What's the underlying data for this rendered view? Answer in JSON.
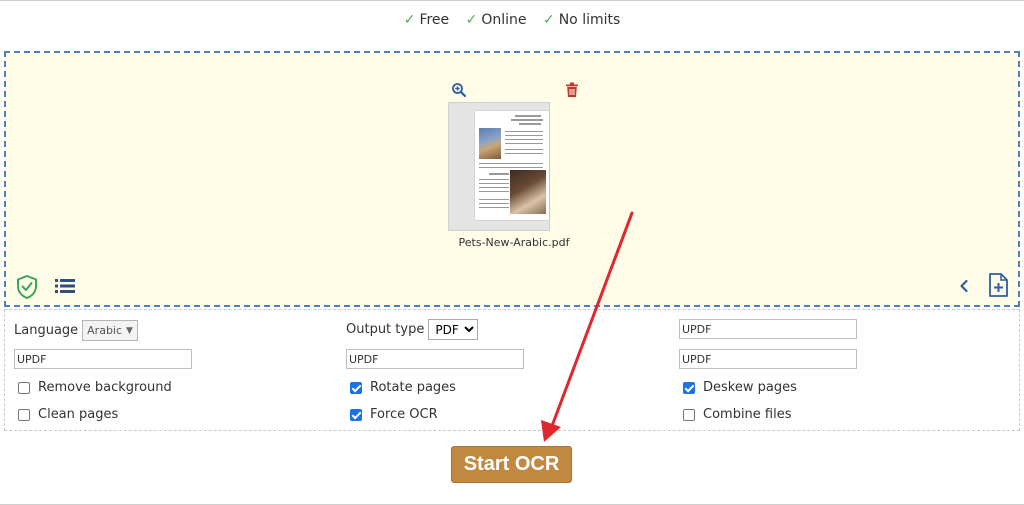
{
  "features": [
    {
      "label": "Free"
    },
    {
      "label": "Online"
    },
    {
      "label": "No limits"
    }
  ],
  "file": {
    "name": "Pets-New-Arabic.pdf"
  },
  "options": {
    "language": {
      "label": "Language",
      "value": "Arabic"
    },
    "output_type": {
      "label": "Output type",
      "value": "PDF",
      "options": [
        "PDF"
      ]
    },
    "fields": [
      "UPDF",
      "UPDF",
      "UPDF",
      "UPDF"
    ],
    "checkboxes": [
      {
        "label": "Remove background",
        "checked": false
      },
      {
        "label": "Rotate pages",
        "checked": true
      },
      {
        "label": "Deskew pages",
        "checked": true
      },
      {
        "label": "Clean pages",
        "checked": false
      },
      {
        "label": "Force OCR",
        "checked": true
      },
      {
        "label": "Combine files",
        "checked": false
      }
    ]
  },
  "action": {
    "start_label": "Start OCR"
  },
  "colors": {
    "accent_button": "#c0893f",
    "drop_bg": "#fffce8",
    "annotation_arrow": "#e0262e"
  },
  "icons": [
    "zoom-in-icon",
    "trash-icon",
    "shield-check-icon",
    "list-icon",
    "chevron-left-icon",
    "add-file-icon"
  ]
}
